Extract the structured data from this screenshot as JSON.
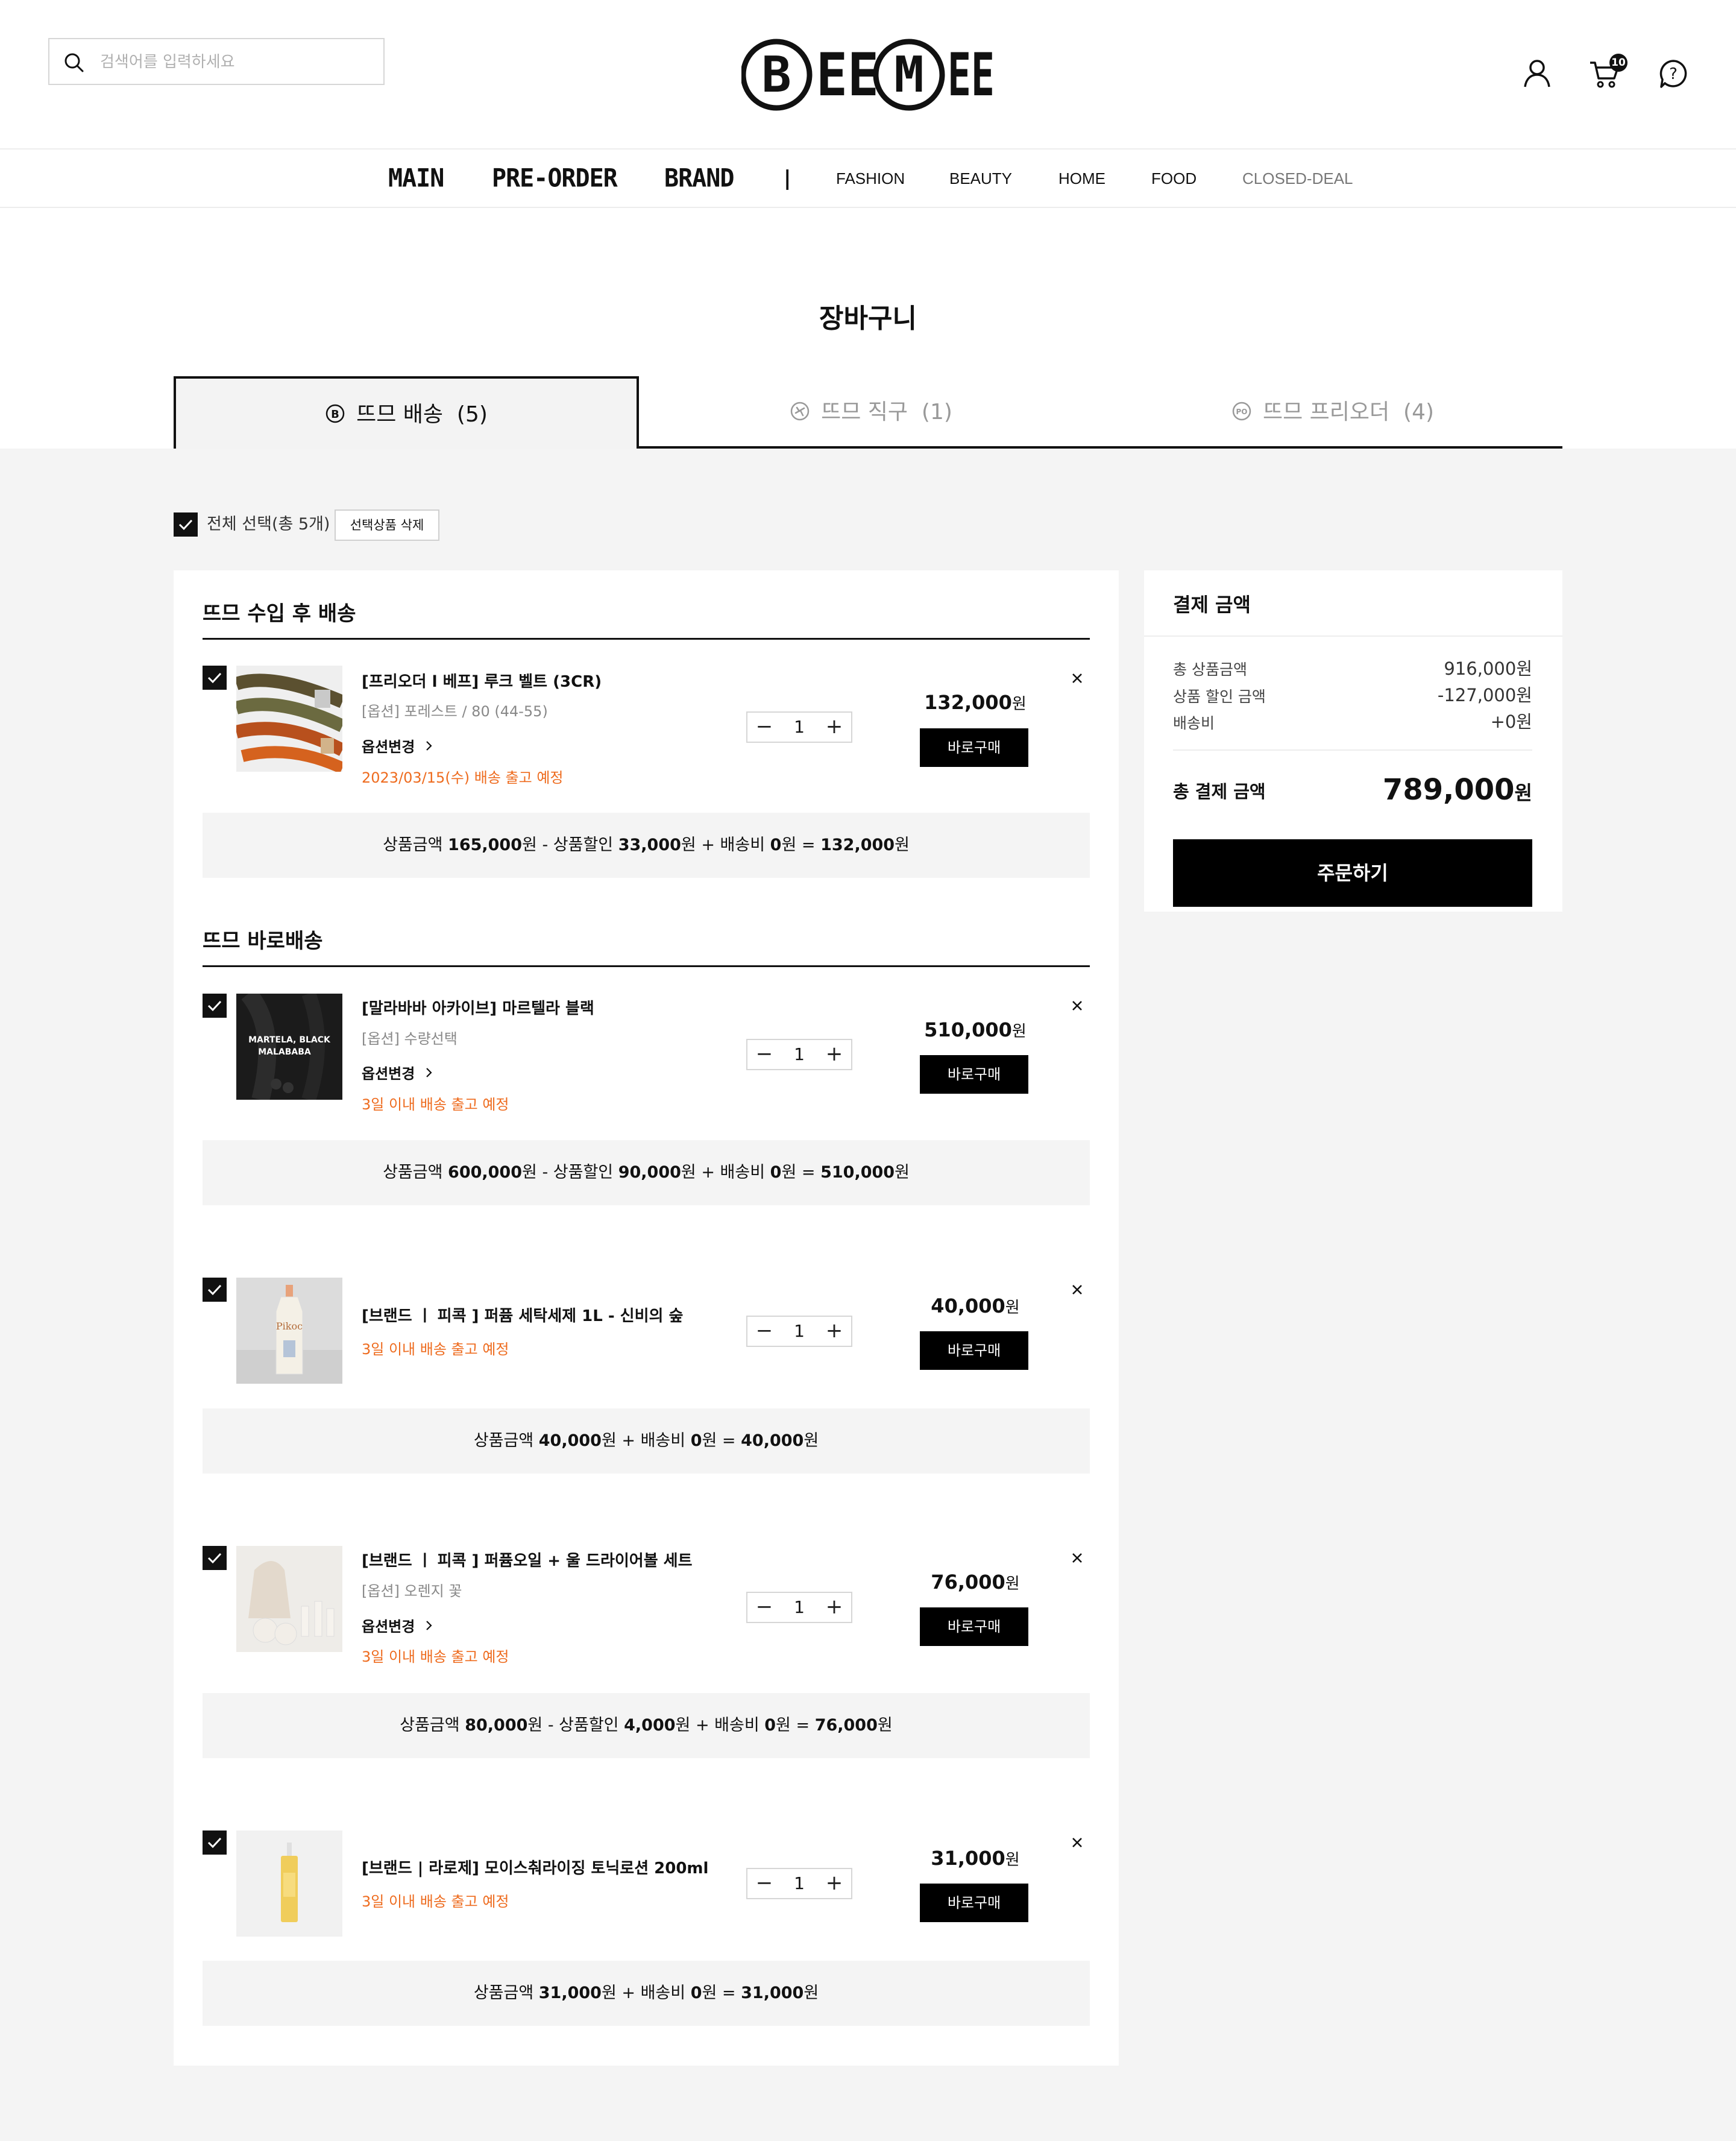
{
  "header": {
    "search_placeholder": "검색어를 입력하세요",
    "brand": "BEEMEE",
    "cart_count": "10"
  },
  "nav": {
    "items": [
      "MAIN",
      "PRE-ORDER",
      "BRAND",
      "FASHION",
      "BEAUTY",
      "HOME",
      "FOOD",
      "CLOSED-DEAL"
    ],
    "divider": "|"
  },
  "page": {
    "title": "장바구니"
  },
  "tabs": [
    {
      "label": "뜨므 배송",
      "count": "(5)",
      "active": true,
      "icon": "b-circle-icon"
    },
    {
      "label": "뜨므 직구",
      "count": "(1)",
      "active": false,
      "icon": "plane-circle-icon"
    },
    {
      "label": "뜨므 프리오더",
      "count": "(4)",
      "active": false,
      "icon": "po-circle-icon"
    }
  ],
  "select_all": {
    "label": "전체 선택(총 5개)",
    "delete_label": "선택상품 삭제"
  },
  "groups": [
    {
      "title": "뜨므 수입 후 배송"
    },
    {
      "title": "뜨므 바로배송"
    }
  ],
  "items": [
    {
      "name": "[프리오더 l 베프] 루크 벨트 (3CR)",
      "option": "[옵션] 포레스트 / 80 (44-55)",
      "change_label": "옵션변경",
      "shipping": "2023/03/15(수) 배송 출고 예정",
      "qty": "1",
      "price": "132,000",
      "won": "원",
      "buy_label": "바로구매",
      "total": [
        "상품금액 ",
        "165,000",
        "원 - 상품할인 ",
        "33,000",
        "원 + 배송비 ",
        "0",
        "원 = ",
        "132,000",
        "원"
      ]
    },
    {
      "name": "[말라바바 아카이브] 마르텔라 블랙",
      "option": "[옵션] 수량선택",
      "change_label": "옵션변경",
      "shipping": "3일 이내 배송 출고 예정",
      "qty": "1",
      "price": "510,000",
      "won": "원",
      "buy_label": "바로구매",
      "thumb_text": [
        "MARTELA, BLACK",
        "MALABABA"
      ],
      "total": [
        "상품금액 ",
        "600,000",
        "원 - 상품할인 ",
        "90,000",
        "원 + 배송비 ",
        "0",
        "원 = ",
        "510,000",
        "원"
      ]
    },
    {
      "name": "[브랜드 ㅣ 피콕 ] 퍼퓸 세탁세제 1L - 신비의 숲",
      "shipping": "3일 이내 배송 출고 예정",
      "qty": "1",
      "price": "40,000",
      "won": "원",
      "buy_label": "바로구매",
      "thumb_text": [
        "Pikoc"
      ],
      "total": [
        "상품금액 ",
        "40,000",
        "원 + 배송비 ",
        "0",
        "원 = ",
        "40,000",
        "원"
      ]
    },
    {
      "name": "[브랜드 ㅣ 피콕 ] 퍼퓸오일 + 울 드라이어볼 세트",
      "option": "[옵션] 오렌지 꽃",
      "change_label": "옵션변경",
      "shipping": "3일 이내 배송 출고 예정",
      "qty": "1",
      "price": "76,000",
      "won": "원",
      "buy_label": "바로구매",
      "total": [
        "상품금액 ",
        "80,000",
        "원 - 상품할인 ",
        "4,000",
        "원 + 배송비 ",
        "0",
        "원 = ",
        "76,000",
        "원"
      ]
    },
    {
      "name": "[브랜드 | 라로제] 모이스춰라이징 토닉로션 200ml",
      "shipping": "3일 이내 배송 출고 예정",
      "qty": "1",
      "price": "31,000",
      "won": "원",
      "buy_label": "바로구매",
      "total": [
        "상품금액 ",
        "31,000",
        "원 + 배송비 ",
        "0",
        "원 = ",
        "31,000",
        "원"
      ]
    }
  ],
  "summary": {
    "title": "결제 금액",
    "rows": [
      {
        "label": "총 상품금액",
        "value": "916,000원"
      },
      {
        "label": "상품 할인 금액",
        "value": "-127,000원"
      },
      {
        "label": "배송비",
        "value": "+0원"
      }
    ],
    "total_label": "총 결제 금액",
    "total_value": "789,000",
    "total_unit": "원",
    "order_label": "주문하기"
  },
  "colors": {
    "accent": "#ee6b1e",
    "primary": "#000000",
    "background": "#f4f4f4"
  }
}
